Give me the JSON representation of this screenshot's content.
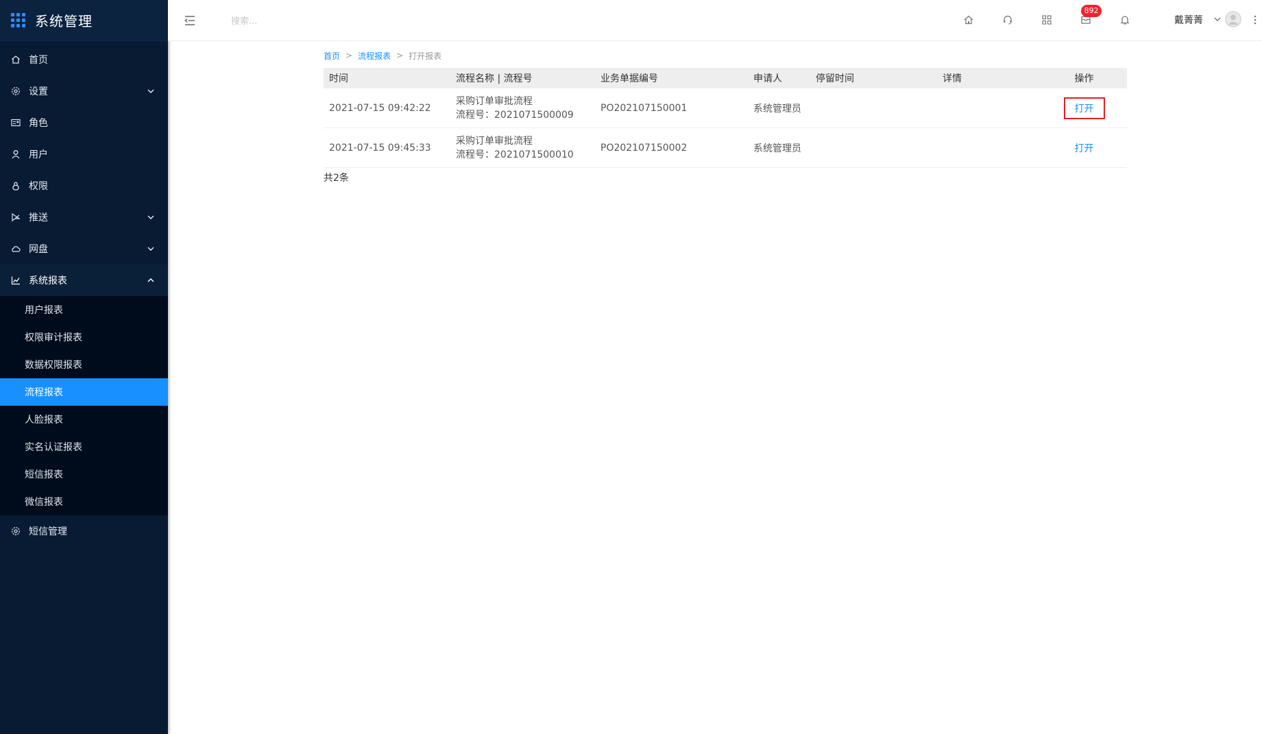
{
  "app": {
    "title": "系统管理"
  },
  "sidebar": {
    "items": [
      {
        "label": "首页",
        "icon": "home-icon"
      },
      {
        "label": "设置",
        "icon": "gear-icon",
        "expandable": true
      },
      {
        "label": "角色",
        "icon": "id-card-icon"
      },
      {
        "label": "用户",
        "icon": "user-icon"
      },
      {
        "label": "权限",
        "icon": "lock-icon"
      },
      {
        "label": "推送",
        "icon": "send-icon",
        "expandable": true
      },
      {
        "label": "网盘",
        "icon": "cloud-icon",
        "expandable": true
      },
      {
        "label": "系统报表",
        "icon": "line-chart-icon",
        "expandable": true,
        "open": true
      },
      {
        "label": "短信管理",
        "icon": "gear-icon"
      }
    ],
    "report_sub": [
      {
        "label": "用户报表"
      },
      {
        "label": "权限审计报表"
      },
      {
        "label": "数据权限报表"
      },
      {
        "label": "流程报表",
        "active": true
      },
      {
        "label": "人脸报表"
      },
      {
        "label": "实名认证报表"
      },
      {
        "label": "短信报表"
      },
      {
        "label": "微信报表"
      }
    ]
  },
  "topbar": {
    "search_placeholder": "搜索...",
    "message_count": "892",
    "user_name": "戴菁菁",
    "icons": [
      "home-icon",
      "headset-icon",
      "apps-icon",
      "mail-icon",
      "bell-icon"
    ]
  },
  "breadcrumb": {
    "home": "首页",
    "sep": ">",
    "parent": "流程报表",
    "current": "打开报表"
  },
  "table": {
    "headers": {
      "time": "时间",
      "flow": "流程名称 | 流程号",
      "doc": "业务单据编号",
      "applicant": "申请人",
      "stay": "停留时间",
      "detail": "详情",
      "action": "操作"
    },
    "rows": [
      {
        "time": "2021-07-15 09:42:22",
        "flow_name": "采购订单审批流程",
        "flow_no": "流程号：2021071500009",
        "doc": "PO202107150001",
        "applicant": "系统管理员",
        "stay": "",
        "detail": "",
        "action": "打开"
      },
      {
        "time": "2021-07-15 09:45:33",
        "flow_name": "采购订单审批流程",
        "flow_no": "流程号：2021071500010",
        "doc": "PO202107150002",
        "applicant": "系统管理员",
        "stay": "",
        "detail": "",
        "action": "打开"
      }
    ],
    "total": "共2条"
  },
  "colors": {
    "sidebar_bg": "#081b33",
    "accent": "#1890ff",
    "badge": "#f5222d",
    "highlight_border": "#e02020"
  }
}
